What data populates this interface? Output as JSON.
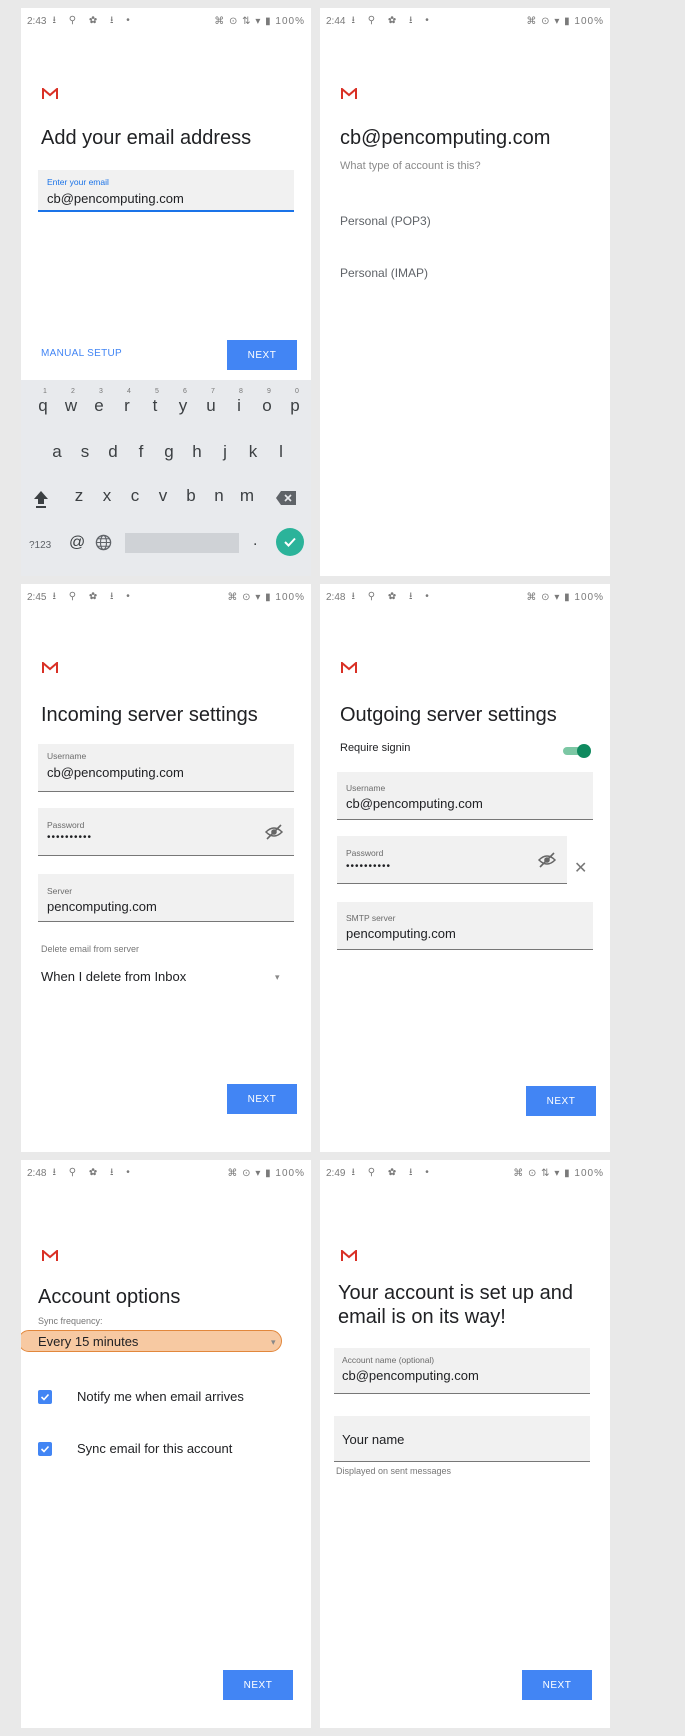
{
  "status_bars": [
    {
      "time": "2:43",
      "indicators": "⭳ ⚲ ✿ ⭳ •",
      "right": "⌘ ⊙ ⇅ ▾ ▮ 100%"
    },
    {
      "time": "2:44",
      "indicators": "⭳ ⚲ ✿ ⭳ •",
      "right": "⌘ ⊙ ▾ ▮ 100%"
    },
    {
      "time": "2:45",
      "indicators": "⭳ ⚲ ✿ ⭳ •",
      "right": "⌘ ⊙ ▾ ▮ 100%"
    },
    {
      "time": "2:48",
      "indicators": "⭳ ⚲ ✿ ⭳ •",
      "right": "⌘ ⊙ ▾ ▮ 100%"
    },
    {
      "time": "2:48",
      "indicators": "⭳ ⚲ ✿ ⭳ •",
      "right": "⌘ ⊙ ▾ ▮ 100%"
    },
    {
      "time": "2:49",
      "indicators": "⭳ ⚲ ✿ ⭳ •",
      "right": "⌘ ⊙ ⇅ ▾ ▮ 100%"
    }
  ],
  "brand": {
    "logo_icon": "gmail-m-icon",
    "color": "#d93025"
  },
  "screen1": {
    "title": "Add your email address",
    "email_label": "Enter your email",
    "email_value": "cb@pencomputing.com",
    "manual_setup": "MANUAL SETUP",
    "next": "NEXT",
    "keyboard": {
      "row1": [
        "q",
        "w",
        "e",
        "r",
        "t",
        "y",
        "u",
        "i",
        "o",
        "p"
      ],
      "row1_nums": [
        "1",
        "2",
        "3",
        "4",
        "5",
        "6",
        "7",
        "8",
        "9",
        "0"
      ],
      "row2": [
        "a",
        "s",
        "d",
        "f",
        "g",
        "h",
        "j",
        "k",
        "l"
      ],
      "row3": [
        "z",
        "x",
        "c",
        "v",
        "b",
        "n",
        "m"
      ],
      "symbols": "?123",
      "at": "@",
      "period": "."
    }
  },
  "screen2": {
    "title": "cb@pencomputing.com",
    "question": "What type of account is this?",
    "options": [
      "Personal (POP3)",
      "Personal (IMAP)"
    ]
  },
  "screen3": {
    "title": "Incoming server settings",
    "username_label": "Username",
    "username_value": "cb@pencomputing.com",
    "password_label": "Password",
    "password_value": "••••••••••",
    "server_label": "Server",
    "server_value": "pencomputing.com",
    "delete_label": "Delete email from server",
    "delete_value": "When I delete from Inbox",
    "next": "NEXT"
  },
  "screen4": {
    "title": "Outgoing server settings",
    "require_signin": "Require signin",
    "require_signin_on": true,
    "username_label": "Username",
    "username_value": "cb@pencomputing.com",
    "password_label": "Password",
    "password_value": "••••••••••",
    "smtp_label": "SMTP server",
    "smtp_value": "pencomputing.com",
    "next": "NEXT"
  },
  "screen5": {
    "title": "Account options",
    "sync_label": "Sync frequency:",
    "sync_value": "Every 15 minutes",
    "notify": "Notify me when email arrives",
    "sync_email": "Sync email for this account",
    "next": "NEXT"
  },
  "screen6": {
    "title_line1": "Your account is set up and",
    "title_line2": "email is on its way!",
    "account_label": "Account name (optional)",
    "account_value": "cb@pencomputing.com",
    "your_name": "Your name",
    "hint": "Displayed on sent messages",
    "next": "NEXT"
  },
  "colors": {
    "accent": "#4285f4",
    "toggle": "#0f8a5f",
    "highlight": "#f7c9a2"
  }
}
